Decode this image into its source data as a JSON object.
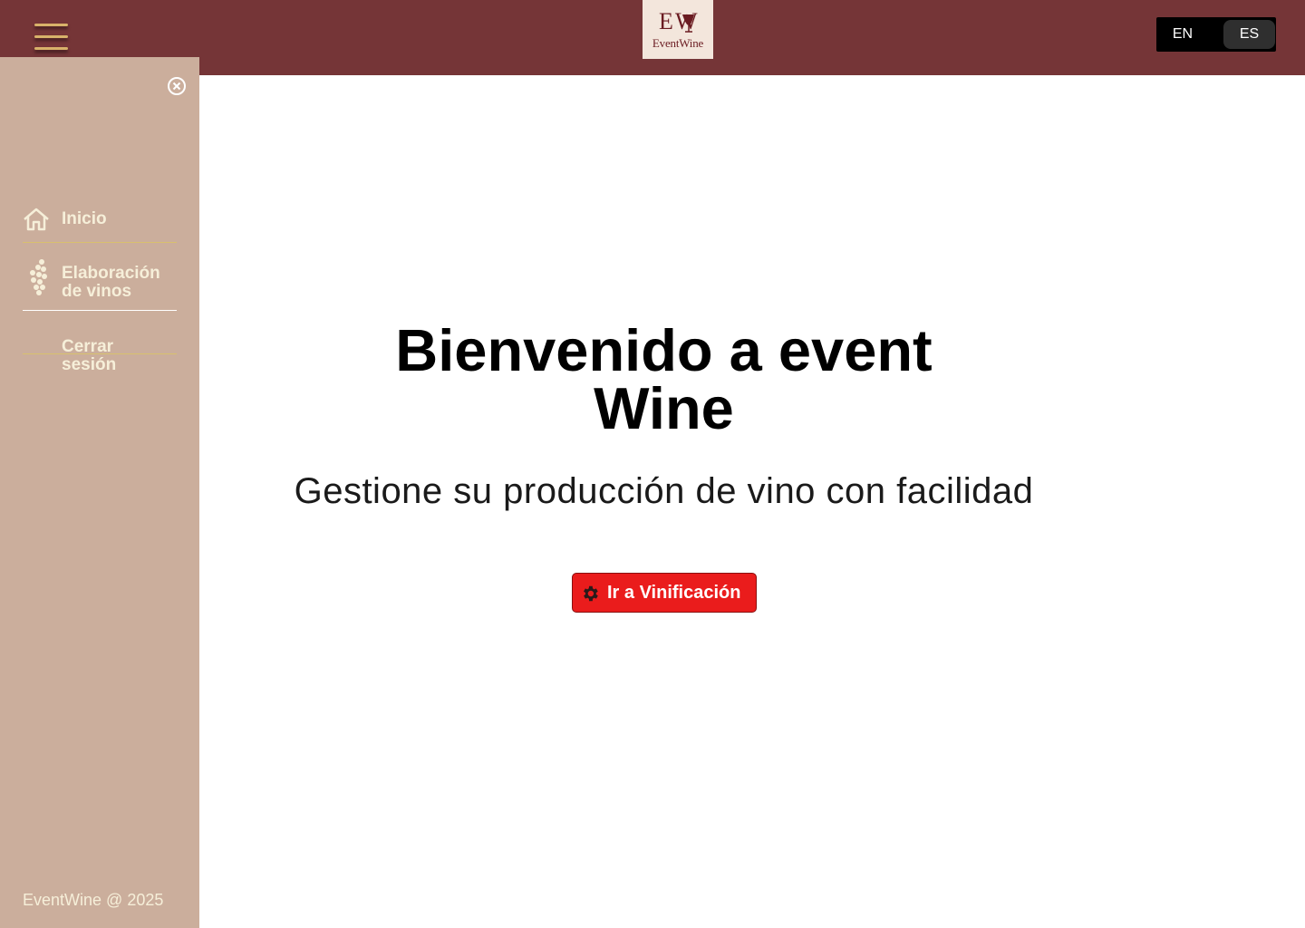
{
  "header": {
    "logo_text": "EventWine",
    "languages": [
      {
        "code": "EN",
        "active": false
      },
      {
        "code": "ES",
        "active": true
      }
    ]
  },
  "sidebar": {
    "items": [
      {
        "label": "Inicio",
        "icon": "home-icon"
      },
      {
        "label": "Elaboración de vinos",
        "icon": "grapes-icon"
      },
      {
        "label": "Cerrar sesión"
      }
    ],
    "footer": "EventWine @ 2025"
  },
  "main": {
    "title": "Bienvenido a event Wine",
    "subtitle": "Gestione su producción de vino con facilidad",
    "cta_label": "Ir a Vinificación",
    "cta_icon": "gear-icon"
  },
  "colors": {
    "topbar": "#753537",
    "sidebar": "#cbae9c",
    "accent_gold": "#d8b26a",
    "cta": "#ea1c1c",
    "logo_bg": "#f3e6dc"
  }
}
